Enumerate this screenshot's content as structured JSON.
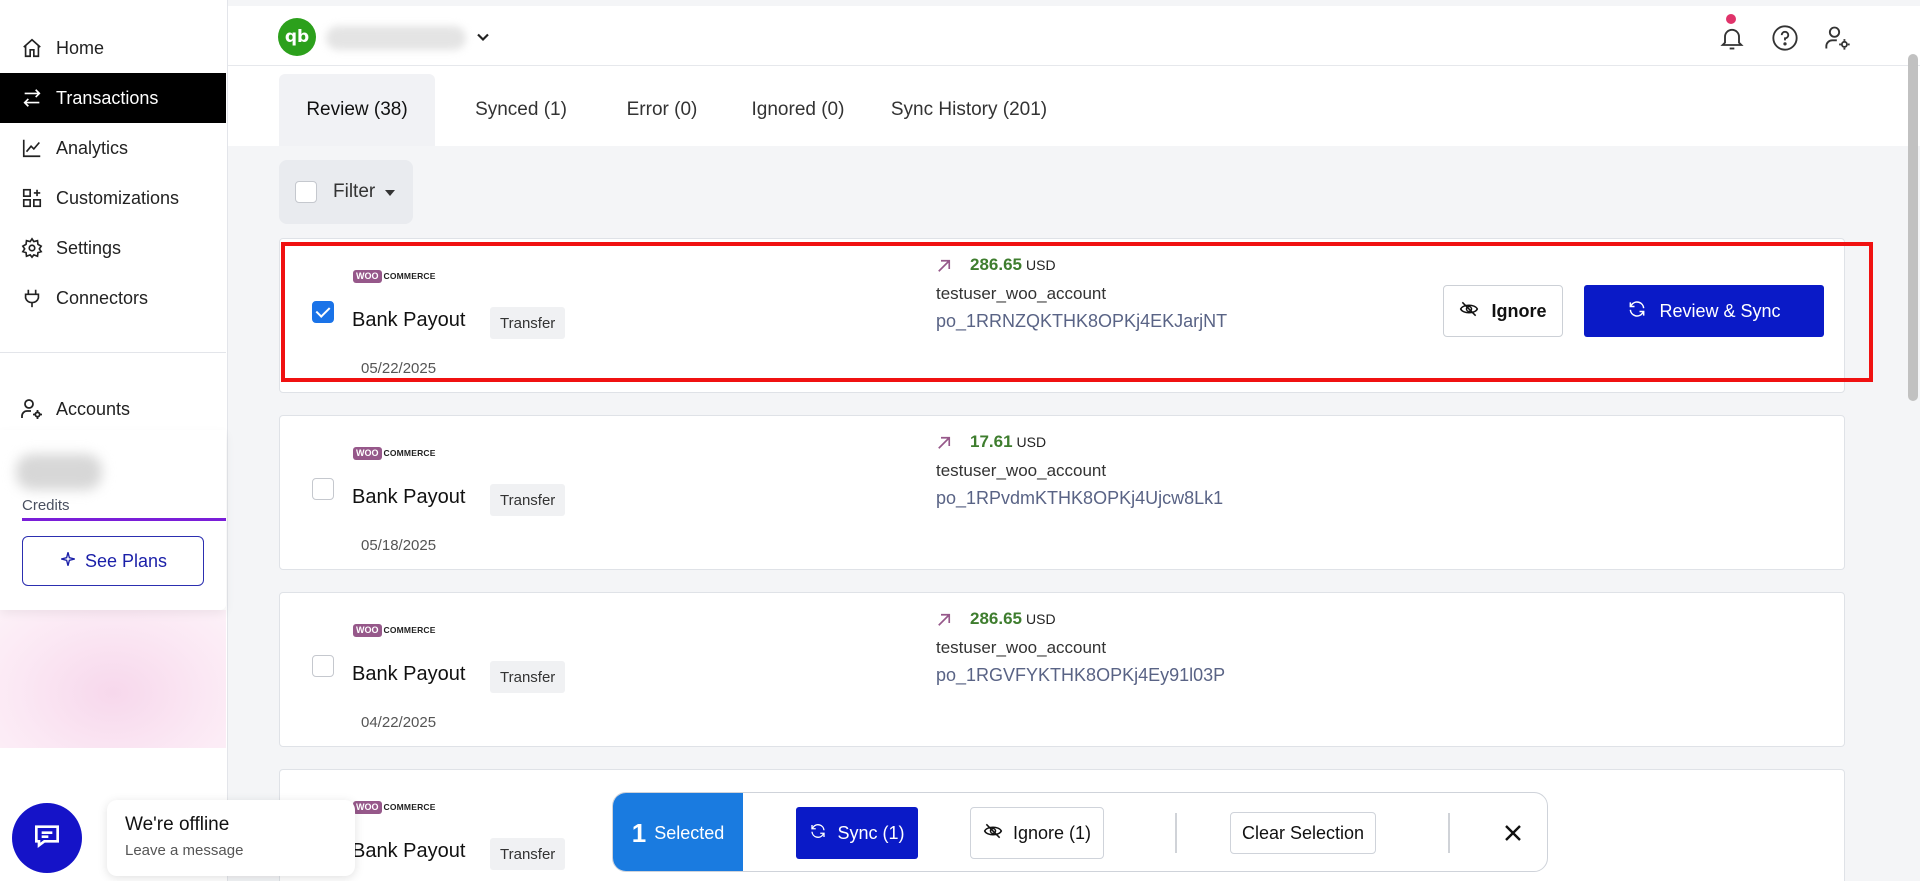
{
  "colors": {
    "accent": "#0a1ac7",
    "selected": "#1a7be0",
    "brand_qb": "#2ca01c",
    "positive_amount": "#3e7d2e",
    "highlight": "#f01111"
  },
  "sidebar": {
    "items": [
      {
        "label": "Home",
        "icon": "home-icon"
      },
      {
        "label": "Transactions",
        "icon": "transfer-arrows-icon",
        "active": true
      },
      {
        "label": "Analytics",
        "icon": "line-chart-icon"
      },
      {
        "label": "Customizations",
        "icon": "grid-plus-icon"
      },
      {
        "label": "Settings",
        "icon": "gear-icon"
      },
      {
        "label": "Connectors",
        "icon": "plug-icon"
      },
      {
        "label": "Accounts",
        "icon": "user-gear-icon"
      }
    ],
    "credits_label": "Credits",
    "see_plans_label": "See Plans"
  },
  "header": {
    "logo_text": "qb"
  },
  "tabs": [
    {
      "label": "Review (38)",
      "active": true
    },
    {
      "label": "Synced (1)"
    },
    {
      "label": "Error (0)"
    },
    {
      "label": "Ignored (0)"
    },
    {
      "label": "Sync History (201)"
    }
  ],
  "filter": {
    "label": "Filter"
  },
  "transactions": [
    {
      "source": "WOO COMMERCE",
      "title": "Bank Payout",
      "type": "Transfer",
      "date": "05/22/2025",
      "amount": "286.65",
      "currency": "USD",
      "account": "testuser_woo_account",
      "payout_id": "po_1RRNZQKTHK8OPKj4EKJarjNT",
      "checked": true,
      "actions": {
        "ignore": "Ignore",
        "sync": "Review & Sync"
      }
    },
    {
      "source": "WOO COMMERCE",
      "title": "Bank Payout",
      "type": "Transfer",
      "date": "05/18/2025",
      "amount": "17.61",
      "currency": "USD",
      "account": "testuser_woo_account",
      "payout_id": "po_1RPvdmKTHK8OPKj4Ujcw8Lk1",
      "checked": false
    },
    {
      "source": "WOO COMMERCE",
      "title": "Bank Payout",
      "type": "Transfer",
      "date": "04/22/2025",
      "amount": "286.65",
      "currency": "USD",
      "account": "testuser_woo_account",
      "payout_id": "po_1RGVFYKTHK8OPKj4Ey91l03P",
      "checked": false
    },
    {
      "source": "WOO COMMERCE",
      "title": "Bank Payout",
      "type": "Transfer"
    }
  ],
  "selection_bar": {
    "count": "1",
    "selected_label": "Selected",
    "sync_label": "Sync (1)",
    "ignore_label": "Ignore (1)",
    "clear_label": "Clear Selection"
  },
  "chat": {
    "title": "We're offline",
    "subtitle": "Leave a message"
  }
}
